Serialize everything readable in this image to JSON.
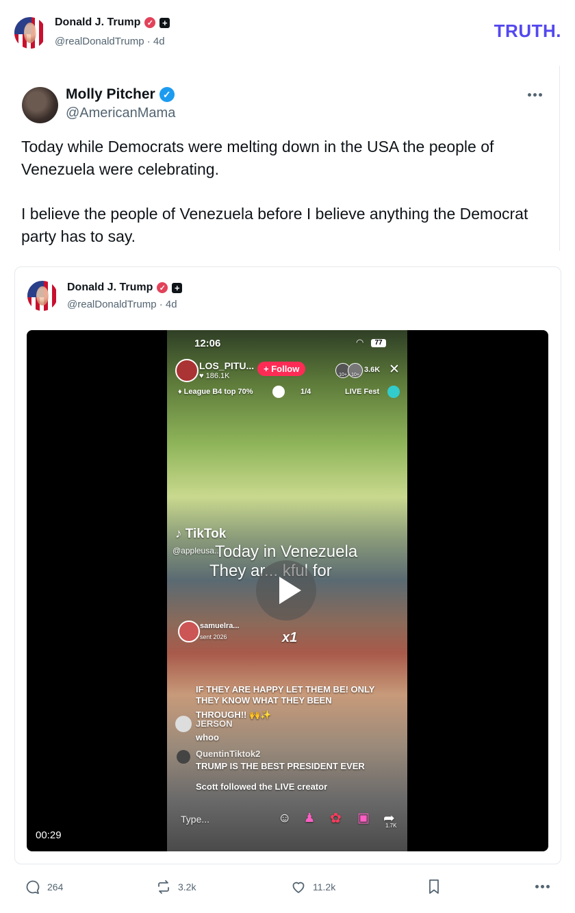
{
  "header": {
    "author_name": "Donald J. Trump",
    "author_handle": "@realDonaldTrump",
    "separator": "·",
    "time": "4d",
    "brand": "TRUTH."
  },
  "quoted_post": {
    "author_name": "Molly Pitcher",
    "author_handle": "@AmericanMama",
    "text_p1": "Today while Democrats were melting down in the USA the people of Venezuela were celebrating.",
    "text_p2": "I believe the people of Venezuela before I believe anything the Democrat party has to say."
  },
  "embedded_post": {
    "author_name": "Donald J. Trump",
    "author_handle": "@realDonaldTrump",
    "separator": "·",
    "time": "4d",
    "video": {
      "duration": "00:29",
      "overlay": {
        "clock": "12:06",
        "battery": "77",
        "streamer": "LOS_PITU...",
        "streamer_likes": "186.1K",
        "follow_label": "+ Follow",
        "viewers_badge_a": "10+",
        "viewers_badge_b": "10+",
        "viewer_count": "3.6K",
        "league": "League B4 top 70%",
        "page_indicator": "1/4",
        "live_fest": "LIVE Fest",
        "tiktok_label": "TikTok",
        "tiktok_handle": "@appleusa...",
        "caption_line1": "Today in Venezuela",
        "caption_line2": "They ar... kful for",
        "gift_user": "samuelra...",
        "gift_sent": "sent 2026",
        "gift_multiplier": "x1",
        "comment1": "IF THEY ARE HAPPY LET THEM BE! ONLY",
        "comment1b": "THEY KNOW WHAT THEY BEEN",
        "comment1c": "THROUGH!! 🙌✨",
        "comment2_user": "JERSON",
        "comment2_text": "whoo",
        "comment3_user": "QuentinTiktok2",
        "comment3_text": "TRUMP IS THE BEST PRESIDENT EVER",
        "comment4": "Scott followed the LIVE creator",
        "type_placeholder": "Type...",
        "share_count": "1.7K"
      }
    }
  },
  "actions": {
    "replies": "264",
    "retruths": "3.2k",
    "likes": "11.2k"
  },
  "colors": {
    "accent_brand": "#5448ee",
    "verified_red": "#e2435a",
    "verified_blue": "#1d9bf0",
    "follow_pink": "#fe2c55"
  },
  "icons": [
    "verified-red-icon",
    "plus-badge-icon",
    "verified-blue-icon",
    "more-icon",
    "play-icon",
    "reply-icon",
    "retruth-icon",
    "like-icon",
    "bookmark-icon"
  ]
}
